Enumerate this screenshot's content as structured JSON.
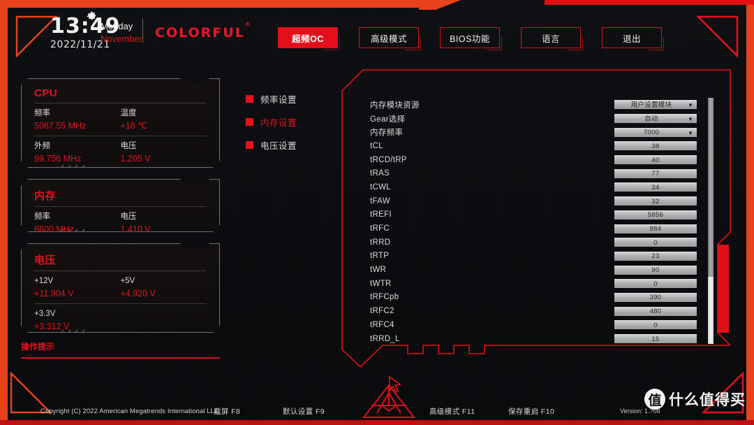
{
  "header": {
    "time": "13:49",
    "date": "2022/11/21",
    "weekday": "Monday",
    "month": "November",
    "brand": "COLORFUL",
    "brand_mark": "®",
    "gear_icon": "gear-icon"
  },
  "tabs": [
    {
      "label": "超频OC",
      "active": true
    },
    {
      "label": "高级模式",
      "active": false
    },
    {
      "label": "BIOS功能",
      "active": false
    },
    {
      "label": "语言",
      "active": false
    },
    {
      "label": "退出",
      "active": false
    }
  ],
  "info_panels": [
    {
      "title": "CPU",
      "rows": [
        [
          {
            "label": "频率",
            "value": "5087.55 MHz"
          },
          {
            "label": "温度",
            "value": "+18 ℃"
          }
        ],
        [
          {
            "label": "外频",
            "value": "99.756 MHz"
          },
          {
            "label": "电压",
            "value": "1.205 V"
          }
        ]
      ]
    },
    {
      "title": "内存",
      "rows": [
        [
          {
            "label": "频率",
            "value": "6600 MHz"
          },
          {
            "label": "电压",
            "value": "1.410 V"
          }
        ]
      ]
    },
    {
      "title": "电压",
      "rows": [
        [
          {
            "label": "+12V",
            "value": "+11.904 V"
          },
          {
            "label": "+5V",
            "value": "+4.920 V"
          }
        ],
        [
          {
            "label": "+3.3V",
            "value": "+3.312 V"
          },
          {
            "label": "",
            "value": ""
          }
        ]
      ]
    }
  ],
  "tips": {
    "title": "操作提示"
  },
  "mid_menu": [
    {
      "label": "频率设置",
      "active": false
    },
    {
      "label": "内存设置",
      "active": true
    },
    {
      "label": "电压设置",
      "active": false
    }
  ],
  "settings": [
    {
      "label": "内存模块资源",
      "value": "用户设置模块",
      "type": "dropdown"
    },
    {
      "label": "Gear选择",
      "value": "自动",
      "type": "dropdown"
    },
    {
      "label": "内存频率",
      "value": "7000",
      "type": "dropdown"
    },
    {
      "label": "tCL",
      "value": "38",
      "type": "field"
    },
    {
      "label": "tRCD/tRP",
      "value": "40",
      "type": "field"
    },
    {
      "label": "tRAS",
      "value": "77",
      "type": "field"
    },
    {
      "label": "tCWL",
      "value": "34",
      "type": "field"
    },
    {
      "label": "tFAW",
      "value": "32",
      "type": "field"
    },
    {
      "label": "tREFI",
      "value": "5856",
      "type": "field"
    },
    {
      "label": "tRFC",
      "value": "884",
      "type": "field"
    },
    {
      "label": "tRRD",
      "value": "0",
      "type": "field"
    },
    {
      "label": "tRTP",
      "value": "23",
      "type": "field"
    },
    {
      "label": "tWR",
      "value": "90",
      "type": "field"
    },
    {
      "label": "tWTR",
      "value": "0",
      "type": "field"
    },
    {
      "label": "tRFCpb",
      "value": "390",
      "type": "field"
    },
    {
      "label": "tRFC2",
      "value": "480",
      "type": "field"
    },
    {
      "label": "tRFC4",
      "value": "0",
      "type": "field"
    },
    {
      "label": "tRRD_L",
      "value": "15",
      "type": "field"
    }
  ],
  "dropdown_caret": "▼",
  "footer": {
    "copyright": "Copyright (C) 2022 American Megatrends International LLC",
    "keys": [
      {
        "label": "截屏 F8"
      },
      {
        "label": "默认设置 F9"
      },
      {
        "label": "高级模式 F11"
      },
      {
        "label": "保存重启 F10"
      }
    ],
    "version": "Version: 1.?08"
  },
  "watermark": {
    "mark": "值",
    "text": "什么值得买"
  },
  "colors": {
    "accent_red": "#e4121f",
    "frame_orange": "#e8421c",
    "field_gray": "#a9abac",
    "panel_border": "#6e7176"
  }
}
